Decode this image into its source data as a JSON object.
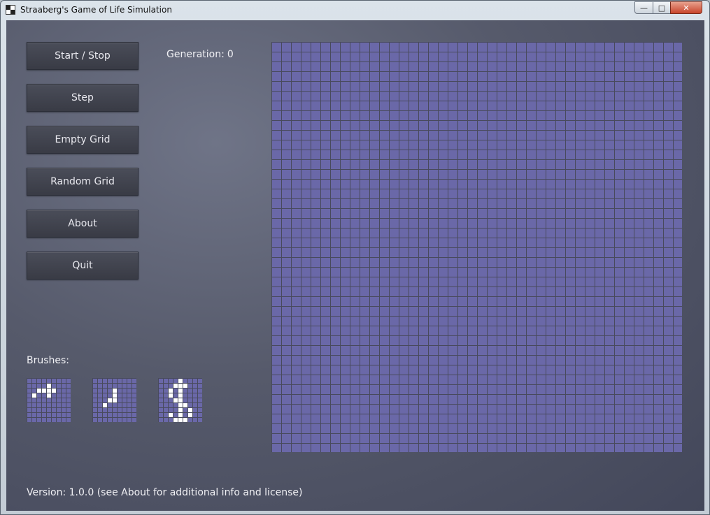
{
  "window": {
    "title": "Straaberg's Game of Life Simulation",
    "controls": {
      "minimize": "—",
      "maximize": "□",
      "close": "✕"
    }
  },
  "sidebar": {
    "buttons": [
      {
        "id": "start-stop",
        "label": "Start / Stop"
      },
      {
        "id": "step",
        "label": "Step"
      },
      {
        "id": "empty-grid",
        "label": "Empty Grid"
      },
      {
        "id": "random-grid",
        "label": "Random Grid"
      },
      {
        "id": "about",
        "label": "About"
      },
      {
        "id": "quit",
        "label": "Quit"
      }
    ]
  },
  "status": {
    "generation_label": "Generation:",
    "generation_value": "0"
  },
  "brushes": {
    "label": "Brushes:",
    "items": [
      {
        "name": "horizontal-brush",
        "cells": [
          [
            4,
            1
          ],
          [
            2,
            2
          ],
          [
            3,
            2
          ],
          [
            4,
            2
          ],
          [
            5,
            2
          ],
          [
            1,
            3
          ],
          [
            4,
            3
          ]
        ]
      },
      {
        "name": "glider-brush",
        "cells": [
          [
            4,
            2
          ],
          [
            4,
            3
          ],
          [
            4,
            4
          ],
          [
            3,
            4
          ],
          [
            2,
            5
          ]
        ]
      },
      {
        "name": "dollar-brush",
        "cells": [
          [
            4,
            0
          ],
          [
            3,
            1
          ],
          [
            4,
            1
          ],
          [
            5,
            1
          ],
          [
            2,
            2
          ],
          [
            4,
            2
          ],
          [
            2,
            3
          ],
          [
            4,
            3
          ],
          [
            3,
            4
          ],
          [
            4,
            4
          ],
          [
            4,
            5
          ],
          [
            5,
            5
          ],
          [
            4,
            6
          ],
          [
            6,
            6
          ],
          [
            2,
            7
          ],
          [
            4,
            7
          ],
          [
            6,
            7
          ],
          [
            3,
            8
          ],
          [
            4,
            8
          ],
          [
            5,
            8
          ],
          [
            4,
            9
          ]
        ]
      }
    ]
  },
  "grid": {
    "columns": 42,
    "rows": 42,
    "cell_color": "#6a68a8",
    "gap_color": "#484a5c",
    "live_color": "#ffffff",
    "live_cells": []
  },
  "footer": {
    "version_text": "Version: 1.0.0 (see About for additional info and license)"
  }
}
